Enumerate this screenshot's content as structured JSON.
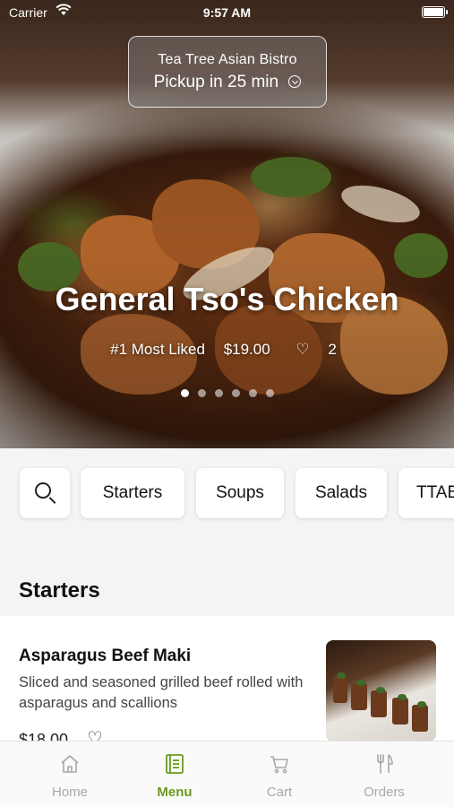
{
  "status_bar": {
    "carrier": "Carrier",
    "time": "9:57 AM"
  },
  "pickup": {
    "restaurant": "Tea Tree Asian Bistro",
    "time_text": "Pickup in 25 min"
  },
  "hero": {
    "title": "General Tso's Chicken",
    "badge": "#1 Most Liked",
    "price": "$19.00",
    "likes": "2",
    "carousel": {
      "count": 6,
      "active_index": 1
    }
  },
  "categories": [
    "Starters",
    "Soups",
    "Salads",
    "TTAB"
  ],
  "section_title": "Starters",
  "item": {
    "name": "Asparagus Beef Maki",
    "description": "Sliced and seasoned grilled beef rolled with asparagus and scallions",
    "price": "$18.00"
  },
  "tabs": [
    {
      "label": "Home",
      "icon": "home-icon"
    },
    {
      "label": "Menu",
      "icon": "menu-icon"
    },
    {
      "label": "Cart",
      "icon": "cart-icon"
    },
    {
      "label": "Orders",
      "icon": "orders-icon"
    }
  ],
  "colors": {
    "accent": "#6a9a1e",
    "inactive": "#a8a8a8"
  }
}
